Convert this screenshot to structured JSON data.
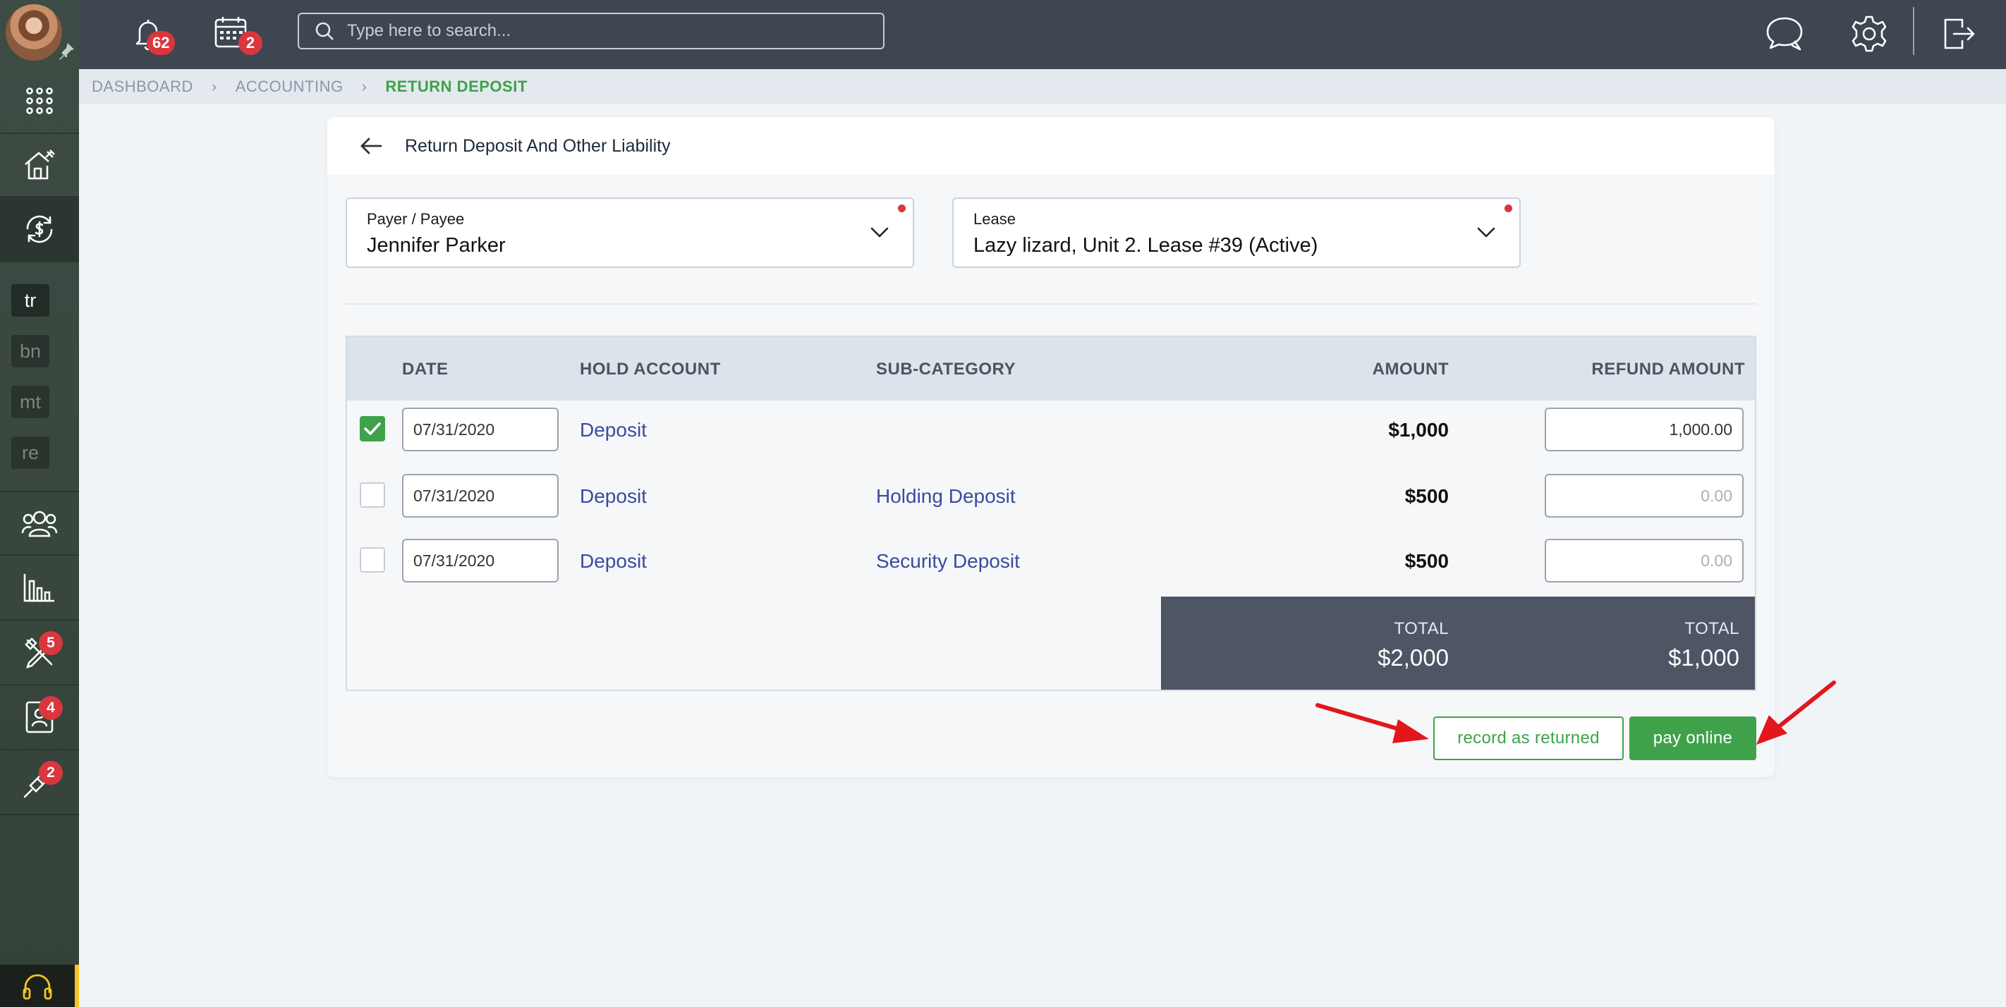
{
  "topbar": {
    "notifications_count": "62",
    "calendar_count": "2",
    "search_placeholder": "Type here to search..."
  },
  "sidebar": {
    "tags": [
      {
        "label": "tr",
        "active": true
      },
      {
        "label": "bn",
        "active": false
      },
      {
        "label": "mt",
        "active": false
      },
      {
        "label": "re",
        "active": false
      }
    ],
    "badges": {
      "tools": "5",
      "contacts": "4",
      "integrations": "2"
    }
  },
  "breadcrumb": {
    "items": [
      "DASHBOARD",
      "ACCOUNTING",
      "RETURN DEPOSIT"
    ]
  },
  "page": {
    "title": "Return Deposit And Other Liability"
  },
  "form": {
    "payer": {
      "label": "Payer / Payee",
      "value": "Jennifer Parker"
    },
    "lease": {
      "label": "Lease",
      "value": "Lazy lizard, Unit 2. Lease #39 (Active)"
    }
  },
  "table": {
    "headers": {
      "date": "DATE",
      "hold_account": "HOLD ACCOUNT",
      "sub_category": "SUB-CATEGORY",
      "amount": "AMOUNT",
      "refund_amount": "REFUND AMOUNT"
    },
    "rows": [
      {
        "checked": true,
        "date": "07/31/2020",
        "hold_account": "Deposit",
        "sub_category": "",
        "amount": "$1,000",
        "refund": "1,000.00",
        "refund_placeholder": ""
      },
      {
        "checked": false,
        "date": "07/31/2020",
        "hold_account": "Deposit",
        "sub_category": "Holding Deposit",
        "amount": "$500",
        "refund": "",
        "refund_placeholder": "0.00"
      },
      {
        "checked": false,
        "date": "07/31/2020",
        "hold_account": "Deposit",
        "sub_category": "Security Deposit",
        "amount": "$500",
        "refund": "",
        "refund_placeholder": "0.00"
      }
    ],
    "totals": {
      "amount_label": "TOTAL",
      "amount_value": "$2,000",
      "refund_label": "TOTAL",
      "refund_value": "$1,000"
    }
  },
  "actions": {
    "record_label": "record as returned",
    "pay_label": "pay online"
  },
  "colors": {
    "accent_green": "#3fa24a",
    "topbar": "#3d4651",
    "sidebar": "#3d4c44",
    "badge_red": "#d9363e",
    "link_blue": "#3a4b9e",
    "annotation_arrow": "#e3161b"
  }
}
